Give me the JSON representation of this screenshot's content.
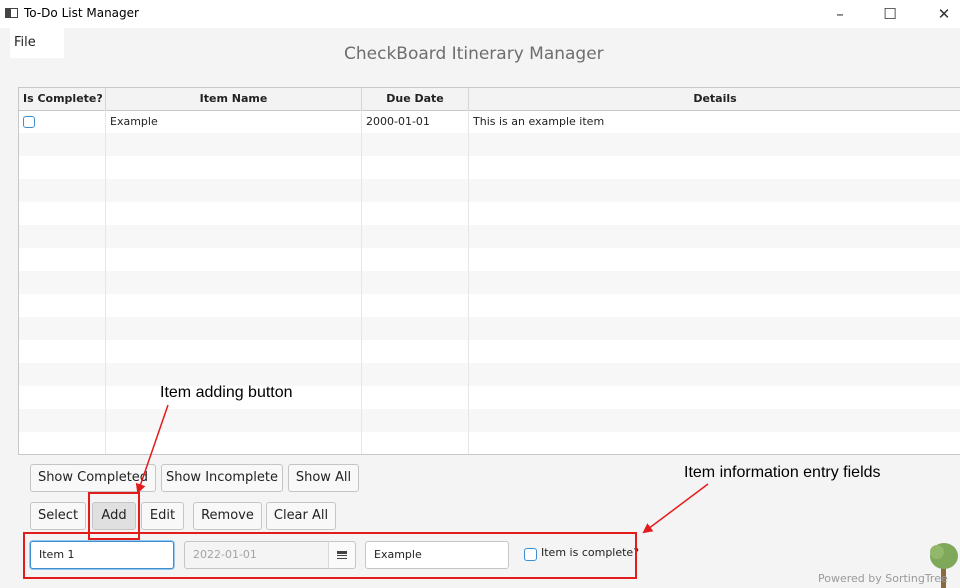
{
  "window": {
    "title": "To-Do List Manager",
    "minimize": "–",
    "maximize": "☐",
    "close": "✕"
  },
  "menu": {
    "file": "File"
  },
  "app_title": "CheckBoard Itinerary Manager",
  "table": {
    "columns": [
      "Is Complete?",
      "Item Name",
      "Due Date",
      "Details"
    ],
    "rows": [
      {
        "complete": false,
        "name": "Example",
        "due": "2000-01-01",
        "details": "This is an example item"
      }
    ]
  },
  "buttons": {
    "show_completed": "Show Completed",
    "show_incomplete": "Show Incomplete",
    "show_all": "Show All",
    "select": "Select",
    "add": "Add",
    "edit": "Edit",
    "remove": "Remove",
    "clear_all": "Clear All"
  },
  "entry": {
    "item_name": "Item 1",
    "due_date": "2022-01-01",
    "details": "Example",
    "complete_label": "Item is complete?"
  },
  "annotations": {
    "add_label": "Item adding button",
    "fields_label": "Item information entry fields"
  },
  "footer": {
    "powered_by": "Powered by SortingTree"
  },
  "colors": {
    "accent": "#3d8fd4",
    "annotation_red": "#e21b1b"
  }
}
